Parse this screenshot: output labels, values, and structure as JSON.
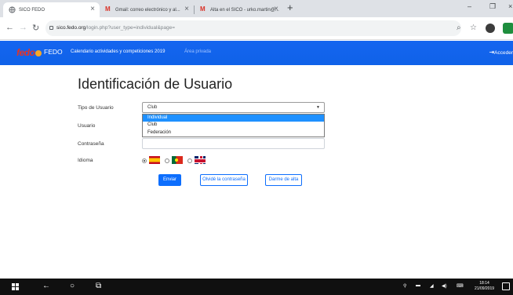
{
  "browser": {
    "tabs": [
      {
        "title": "SICO FEDO",
        "active": true
      },
      {
        "title": "Gmail: correo electrónico y al...",
        "active": false
      },
      {
        "title": "Alta en el SICO - urko.martin@...",
        "active": false
      }
    ],
    "new_tab": "+",
    "url_host": "sico.fedo.org",
    "url_path": "/login.php?user_type=individual&page="
  },
  "site_nav": {
    "logo": "fedo",
    "brand": "FEDO",
    "links": [
      "Calendario actividades y competiciones 2019",
      "Área privada"
    ],
    "login": "Acceder"
  },
  "form": {
    "title": "Identificación de Usuario",
    "tipo_label": "Tipo de Usuario",
    "tipo_value": "Club",
    "tipo_options": [
      "Individual",
      "Club",
      "Federación"
    ],
    "usuario_label": "Usuario",
    "password_label": "Contraseña",
    "idioma_label": "Idioma",
    "buttons": {
      "submit": "Enviar",
      "forgot": "Olvidé la contraseña",
      "signup": "Darme de alta"
    }
  },
  "taskbar": {
    "time": "18:14",
    "date": "21/09/2019"
  },
  "colors": {
    "nav_blue": "#1565f0",
    "primary": "#0d6efd",
    "selected_option": "#1e90ff",
    "logo_red": "#e63325"
  }
}
